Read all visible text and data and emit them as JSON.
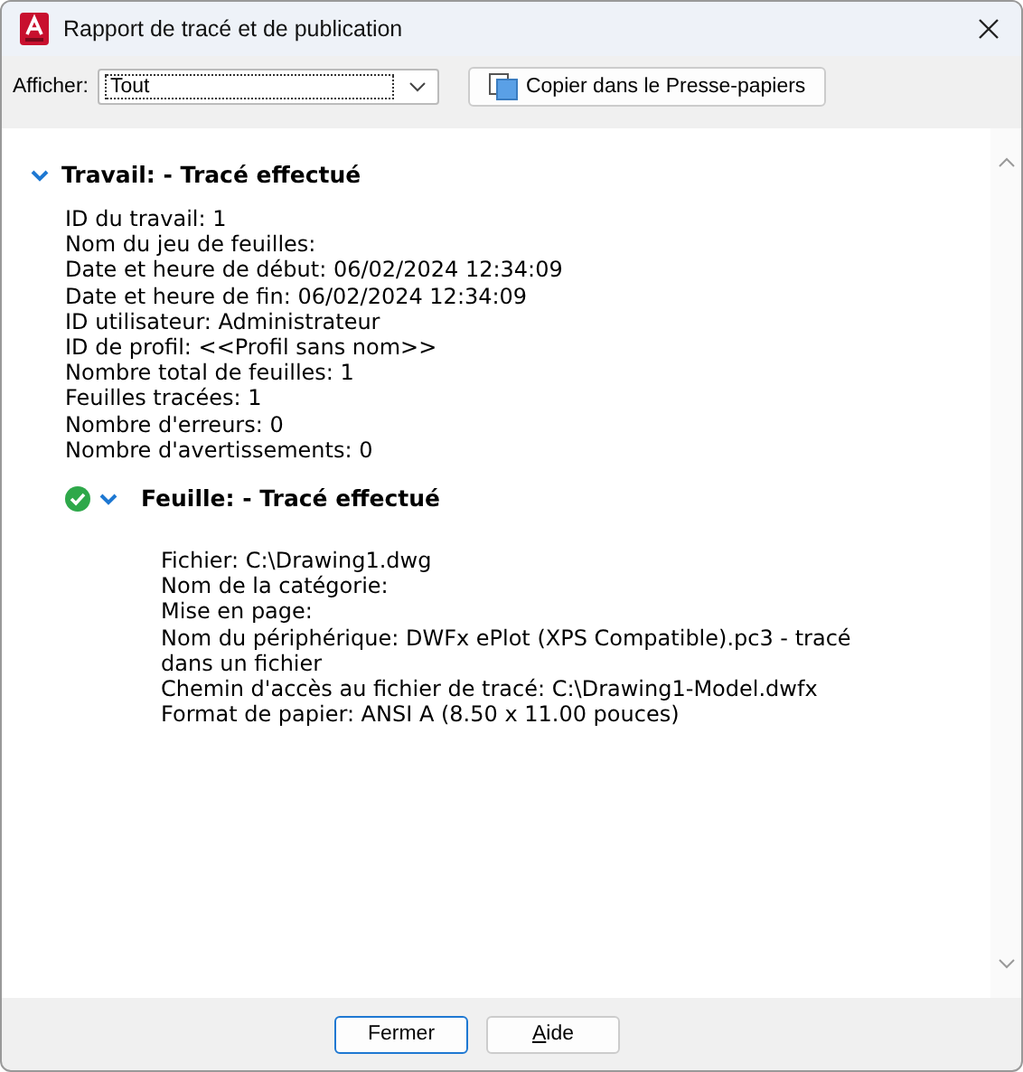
{
  "window": {
    "title": "Rapport de tracé et de publication"
  },
  "toolbar": {
    "show_label": "Afficher:",
    "show_value": "Tout",
    "copy_button": "Copier dans le Presse-papiers"
  },
  "job": {
    "title": "Travail: - Tracé effectué",
    "expanded": true,
    "lines": [
      "ID du travail: 1",
      "Nom du jeu de feuilles:",
      "Date et heure de début: 06/02/2024 12:34:09",
      "Date et heure de fin: 06/02/2024 12:34:09",
      "ID utilisateur: Administrateur",
      "ID de profil: <<Profil sans nom>>",
      "Nombre total de feuilles: 1",
      "Feuilles tracées: 1",
      "Nombre d'erreurs: 0",
      "Nombre d'avertissements: 0"
    ],
    "sheets": [
      {
        "title": "Feuille: - Tracé effectué",
        "succeeded": true,
        "expanded": true,
        "lines": [
          "Fichier: C:\\Drawing1.dwg",
          "Nom de la catégorie:",
          "Mise en page:",
          "Nom du périphérique: DWFx ePlot (XPS Compatible).pc3 - tracé dans un fichier",
          "Chemin d'accès au fichier de tracé: C:\\Drawing1-Model.dwfx",
          "Format de papier: ANSI A (8.50 x 11.00 pouces)"
        ]
      }
    ]
  },
  "buttons": [
    "Fermer",
    "Aide"
  ]
}
